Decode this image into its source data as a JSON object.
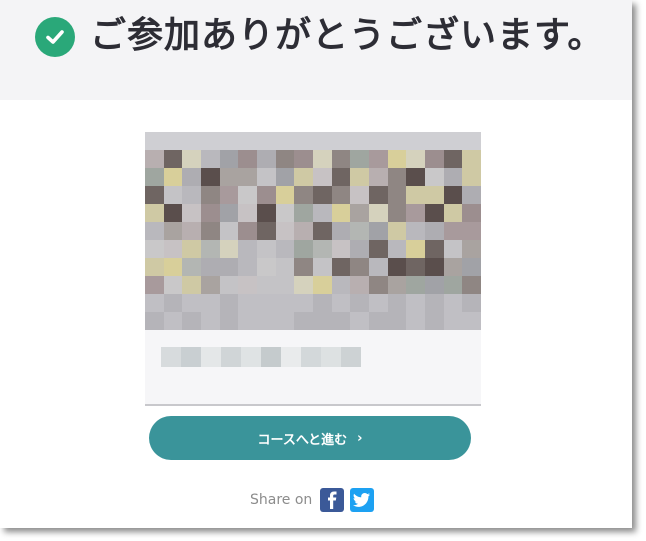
{
  "header": {
    "title": "ご参加ありがとうございます。",
    "icon": "check-circle-icon",
    "icon_color": "#2aa879"
  },
  "course_card": {
    "image": "blurred-course-thumbnail"
  },
  "cta": {
    "label": "コースへと進む",
    "arrow": "›",
    "color": "#3a949a"
  },
  "share": {
    "label": "Share on",
    "networks": [
      {
        "name": "facebook-icon",
        "color": "#3b5998"
      },
      {
        "name": "twitter-icon",
        "color": "#1da1f2"
      }
    ]
  }
}
